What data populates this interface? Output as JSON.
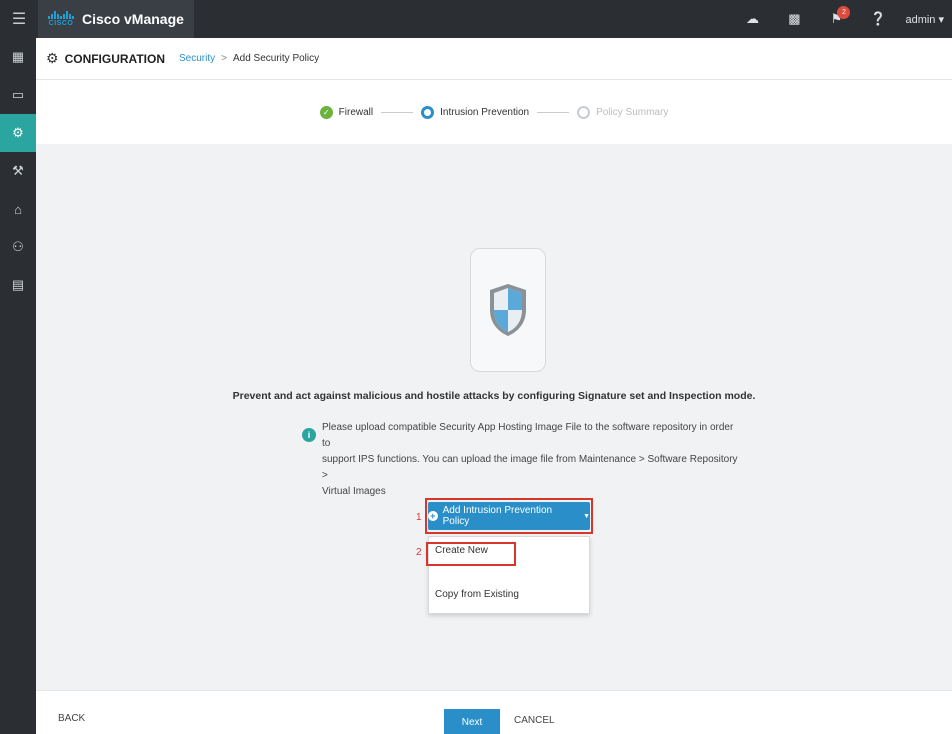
{
  "topbar": {
    "menu_icon": "hamburger-icon",
    "cisco_word": "CISCO",
    "app_title": "Cisco vManage",
    "icons": [
      "cloud-icon",
      "clipboard-icon",
      "bell-icon",
      "help-icon"
    ],
    "notification_count": "2",
    "user_label": "admin ▾"
  },
  "sidebar": {
    "items": [
      {
        "icon": "dashboard-icon",
        "glyph": "▦"
      },
      {
        "icon": "monitor-icon",
        "glyph": "▭"
      },
      {
        "icon": "gear-icon",
        "glyph": "⚙",
        "active": true
      },
      {
        "icon": "wrench-icon",
        "glyph": "⚒"
      },
      {
        "icon": "admin-icon",
        "glyph": "⌂"
      },
      {
        "icon": "users-icon",
        "glyph": "⚇"
      },
      {
        "icon": "analytics-icon",
        "glyph": "▤"
      }
    ]
  },
  "header": {
    "title": "CONFIGURATION",
    "breadcrumb_link": "Security",
    "breadcrumb_sep": ">",
    "breadcrumb_current": "Add Security Policy"
  },
  "stepper": {
    "steps": [
      {
        "label": "Firewall",
        "state": "done"
      },
      {
        "label": "Intrusion Prevention",
        "state": "active"
      },
      {
        "label": "Policy Summary",
        "state": "pending"
      }
    ]
  },
  "main": {
    "lead": "Prevent and act against malicious and hostile attacks by configuring Signature set and Inspection mode.",
    "info_line_1": "Please upload compatible Security App Hosting Image File to the software repository in order to",
    "info_line_2": "support IPS functions. You can upload the image file from Maintenance > Software Repository >",
    "info_line_3": "Virtual Images",
    "callout_1": "1",
    "callout_2": "2",
    "add_policy_label": "Add Intrusion Prevention Policy",
    "dropdown": {
      "items": [
        "Create New",
        "Copy from Existing"
      ]
    }
  },
  "footer": {
    "back_label": "BACK",
    "next_label": "Next",
    "cancel_label": "CANCEL"
  },
  "colors": {
    "topbar": "#2b2f33",
    "accent_teal": "#2aa5a0",
    "primary_blue": "#2a8fc9",
    "annotation_red": "#d9352b",
    "step_done_green": "#6cb33e"
  }
}
